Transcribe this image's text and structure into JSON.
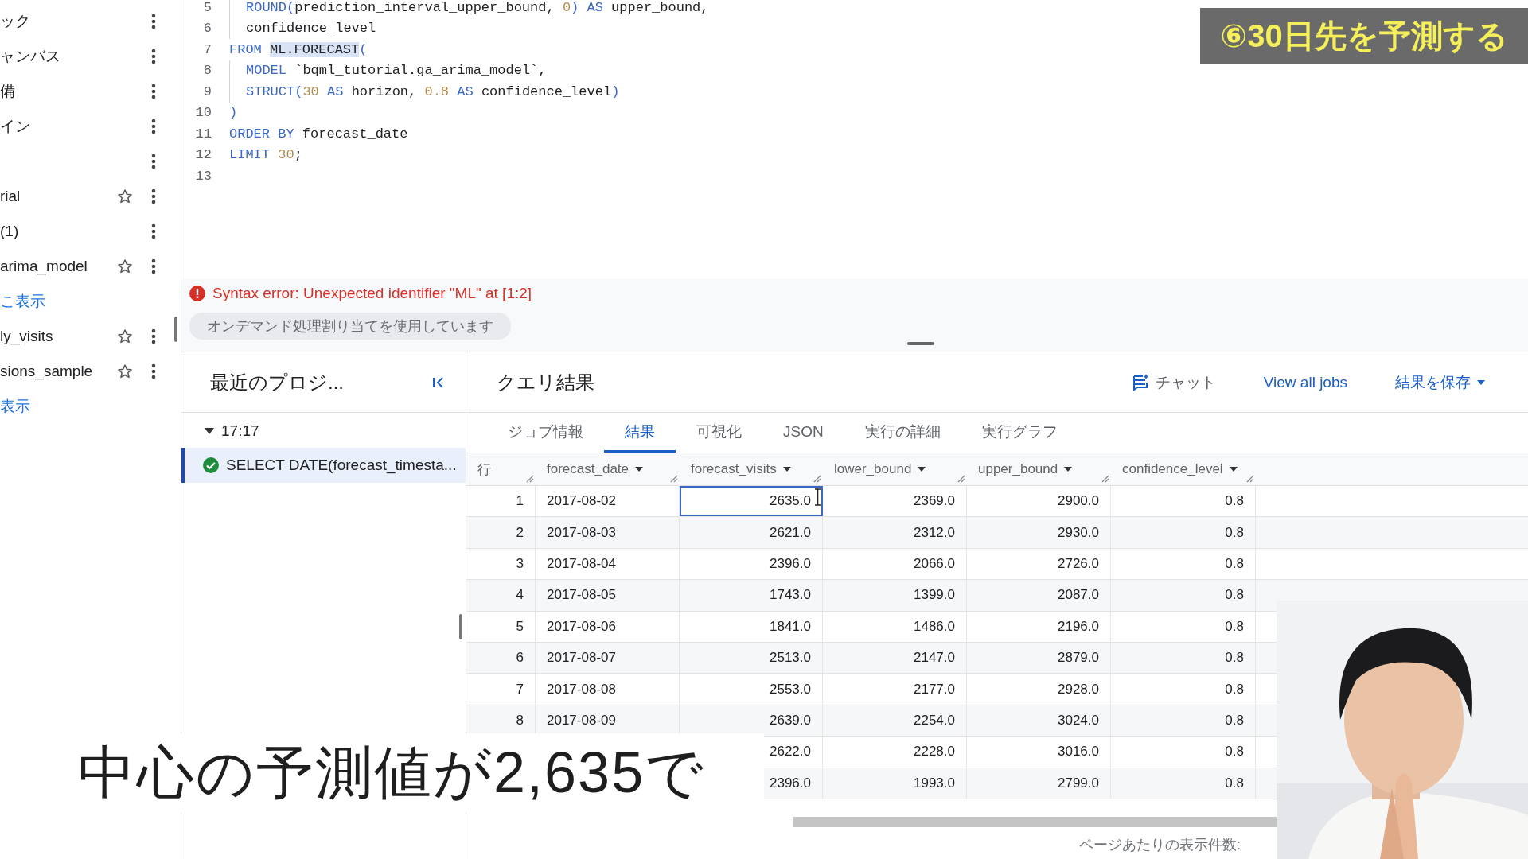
{
  "sidebar": {
    "items": [
      {
        "label": "ック",
        "kind": "item",
        "star": false
      },
      {
        "label": "ャンバス",
        "kind": "item",
        "star": false
      },
      {
        "label": "備",
        "kind": "item",
        "star": false
      },
      {
        "label": "イン",
        "kind": "item",
        "star": false
      },
      {
        "kind": "item",
        "star": false
      },
      {
        "label": "rial",
        "kind": "item",
        "star": true
      },
      {
        "label": "(1)",
        "kind": "item",
        "star": false
      },
      {
        "label": "arima_model",
        "kind": "item",
        "star": true
      },
      {
        "label": "こ表示",
        "kind": "link"
      },
      {
        "label": "ly_visits",
        "kind": "item",
        "star": true
      },
      {
        "label": "sions_sample",
        "kind": "item",
        "star": true
      },
      {
        "label": "表示",
        "kind": "link"
      }
    ]
  },
  "editor": {
    "lines": [
      {
        "number": "5",
        "indent": true,
        "tokens": [
          {
            "text": "ROUND(",
            "kind": "keyword"
          },
          {
            "text": "prediction_interval_upper_bound, ",
            "kind": "plain"
          },
          {
            "text": "0",
            "kind": "number"
          },
          {
            "text": ") AS",
            "kind": "keyword"
          },
          {
            "text": " upper_bound,",
            "kind": "plain"
          }
        ]
      },
      {
        "number": "6",
        "indent": true,
        "tokens": [
          {
            "text": "confidence_level",
            "kind": "plain"
          }
        ]
      },
      {
        "number": "7",
        "indent": false,
        "tokens": [
          {
            "text": "FROM ",
            "kind": "keyword"
          },
          {
            "text": "ML.FORECAST",
            "kind": "highlight"
          },
          {
            "text": "(",
            "kind": "keyword"
          }
        ]
      },
      {
        "number": "8",
        "indent": true,
        "tokens": [
          {
            "text": "MODEL",
            "kind": "keyword"
          },
          {
            "text": " `bqml_tutorial.ga_arima_model`,",
            "kind": "plain"
          }
        ]
      },
      {
        "number": "9",
        "indent": true,
        "tokens": [
          {
            "text": "STRUCT(",
            "kind": "keyword"
          },
          {
            "text": "30",
            "kind": "number"
          },
          {
            "text": " AS",
            "kind": "keyword"
          },
          {
            "text": " horizon, ",
            "kind": "plain"
          },
          {
            "text": "0.8",
            "kind": "number"
          },
          {
            "text": " AS",
            "kind": "keyword"
          },
          {
            "text": " confidence_level",
            "kind": "plain"
          },
          {
            "text": ")",
            "kind": "keyword"
          }
        ]
      },
      {
        "number": "10",
        "indent": false,
        "tokens": [
          {
            "text": ")",
            "kind": "keyword"
          }
        ]
      },
      {
        "number": "11",
        "indent": false,
        "tokens": [
          {
            "text": "ORDER BY",
            "kind": "keyword"
          },
          {
            "text": " forecast_date",
            "kind": "plain"
          }
        ]
      },
      {
        "number": "12",
        "indent": false,
        "tokens": [
          {
            "text": "LIMIT ",
            "kind": "keyword"
          },
          {
            "text": "30",
            "kind": "number"
          },
          {
            "text": ";",
            "kind": "plain"
          }
        ]
      },
      {
        "number": "13",
        "indent": false
      }
    ]
  },
  "error": "Syntax error: Unexpected identifier \"ML\" at [1:2]",
  "notice": "オンデマンド処理割り当てを使用しています",
  "history": {
    "title": "最近のプロジ...",
    "groups": [
      {
        "time": "17:17",
        "expanded": true,
        "children": [
          {
            "label": "SELECT DATE(forecast_timesta...",
            "selected": true
          }
        ]
      }
    ]
  },
  "results": {
    "title": "クエリ結果",
    "actions": {
      "chat": "チャット",
      "view_jobs": "View all jobs",
      "save": "結果を保存"
    },
    "tabs": [
      {
        "label": "ジョブ情報",
        "selected": false
      },
      {
        "label": "結果",
        "selected": true
      },
      {
        "label": "可視化",
        "selected": false
      },
      {
        "label": "JSON",
        "selected": false
      },
      {
        "label": "実行の詳細",
        "selected": false
      },
      {
        "label": "実行グラフ",
        "selected": false
      }
    ],
    "columns": [
      "行",
      "forecast_date",
      "forecast_visits",
      "lower_bound",
      "upper_bound",
      "confidence_level"
    ],
    "rows": [
      {
        "row": "1",
        "date": "2017-08-02",
        "visits": "2635.0",
        "lower": "2369.0",
        "upper": "2900.0",
        "confidence": "0.8",
        "focused": true
      },
      {
        "row": "2",
        "date": "2017-08-03",
        "visits": "2621.0",
        "lower": "2312.0",
        "upper": "2930.0",
        "confidence": "0.8",
        "focused": false
      },
      {
        "row": "3",
        "date": "2017-08-04",
        "visits": "2396.0",
        "lower": "2066.0",
        "upper": "2726.0",
        "confidence": "0.8",
        "focused": false
      },
      {
        "row": "4",
        "date": "2017-08-05",
        "visits": "1743.0",
        "lower": "1399.0",
        "upper": "2087.0",
        "confidence": "0.8",
        "focused": false
      },
      {
        "row": "5",
        "date": "2017-08-06",
        "visits": "1841.0",
        "lower": "1486.0",
        "upper": "2196.0",
        "confidence": "0.8",
        "focused": false
      },
      {
        "row": "6",
        "date": "2017-08-07",
        "visits": "2513.0",
        "lower": "2147.0",
        "upper": "2879.0",
        "confidence": "0.8",
        "focused": false
      },
      {
        "row": "7",
        "date": "2017-08-08",
        "visits": "2553.0",
        "lower": "2177.0",
        "upper": "2928.0",
        "confidence": "0.8",
        "focused": false
      },
      {
        "row": "8",
        "date": "2017-08-09",
        "visits": "2639.0",
        "lower": "2254.0",
        "upper": "3024.0",
        "confidence": "0.8",
        "focused": false
      },
      {
        "visits": "2622.0",
        "lower": "2228.0",
        "upper": "3016.0",
        "confidence": "0.8",
        "focused": false
      },
      {
        "visits": "2396.0",
        "lower": "1993.0",
        "upper": "2799.0",
        "confidence": "0.8",
        "focused": false
      }
    ],
    "footer": "ページあたりの表示件数:"
  },
  "overlay": {
    "title": "⑥30日先を予測する",
    "subtitle": "中心の予測値が2,635で"
  }
}
